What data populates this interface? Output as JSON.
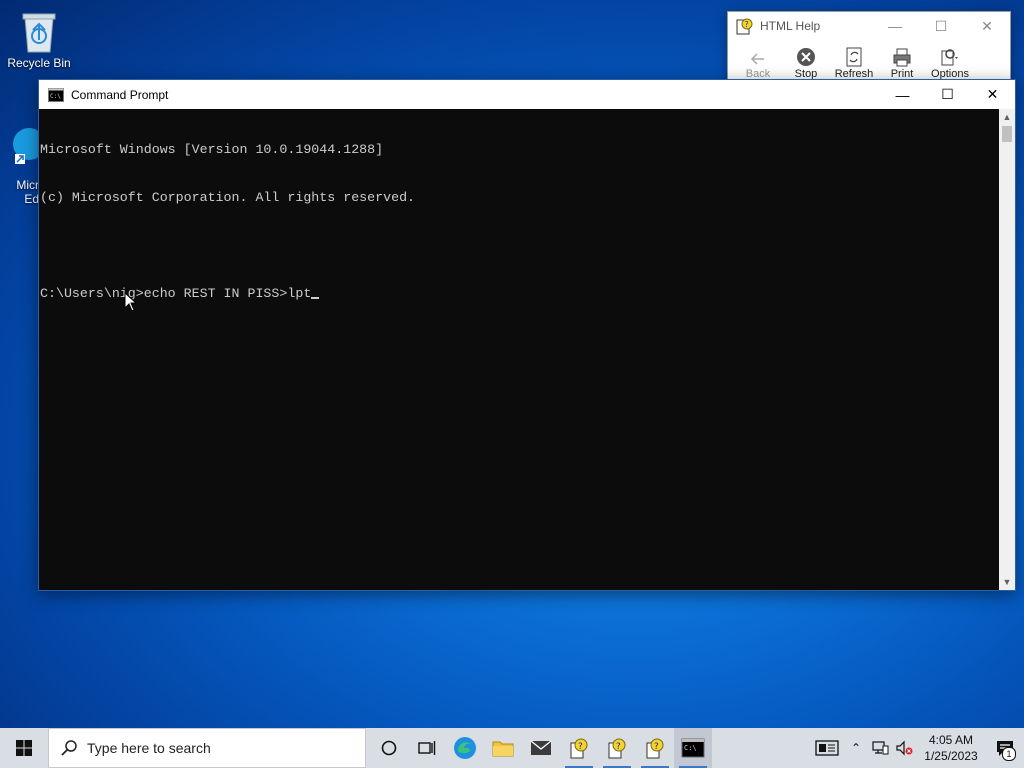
{
  "desktop": {
    "icons": [
      {
        "label": "Recycle Bin",
        "icon": "recycle-bin-icon"
      },
      {
        "label": "Micr\nEd",
        "icon": "edge-shortcut-icon"
      }
    ]
  },
  "html_help": {
    "title": "HTML Help",
    "toolbar": [
      {
        "label": "Back",
        "icon": "back-arrow-icon",
        "enabled": false
      },
      {
        "label": "Stop",
        "icon": "stop-icon",
        "enabled": true
      },
      {
        "label": "Refresh",
        "icon": "refresh-icon",
        "enabled": true
      },
      {
        "label": "Print",
        "icon": "printer-icon",
        "enabled": true
      },
      {
        "label": "Options",
        "icon": "options-icon",
        "enabled": true
      }
    ]
  },
  "cmd": {
    "title": "Command Prompt",
    "lines": [
      "Microsoft Windows [Version 10.0.19044.1288]",
      "(c) Microsoft Corporation. All rights reserved.",
      "",
      "C:\\Users\\nig>echo REST IN PISS>lpt"
    ]
  },
  "taskbar": {
    "search_placeholder": "Type here to search",
    "apps": [
      "cortana-icon",
      "task-view-icon",
      "edge-icon",
      "file-explorer-icon",
      "mail-icon",
      "html-help-icon",
      "html-help-icon",
      "html-help-icon",
      "command-prompt-icon"
    ],
    "clock_time": "4:05 AM",
    "clock_date": "1/25/2023",
    "notification_count": "1"
  },
  "colors": {
    "console_bg": "#0c0c0c",
    "console_fg": "#cccccc",
    "taskbar_bg": "#d9dde4",
    "accent": "#3a78c9"
  }
}
